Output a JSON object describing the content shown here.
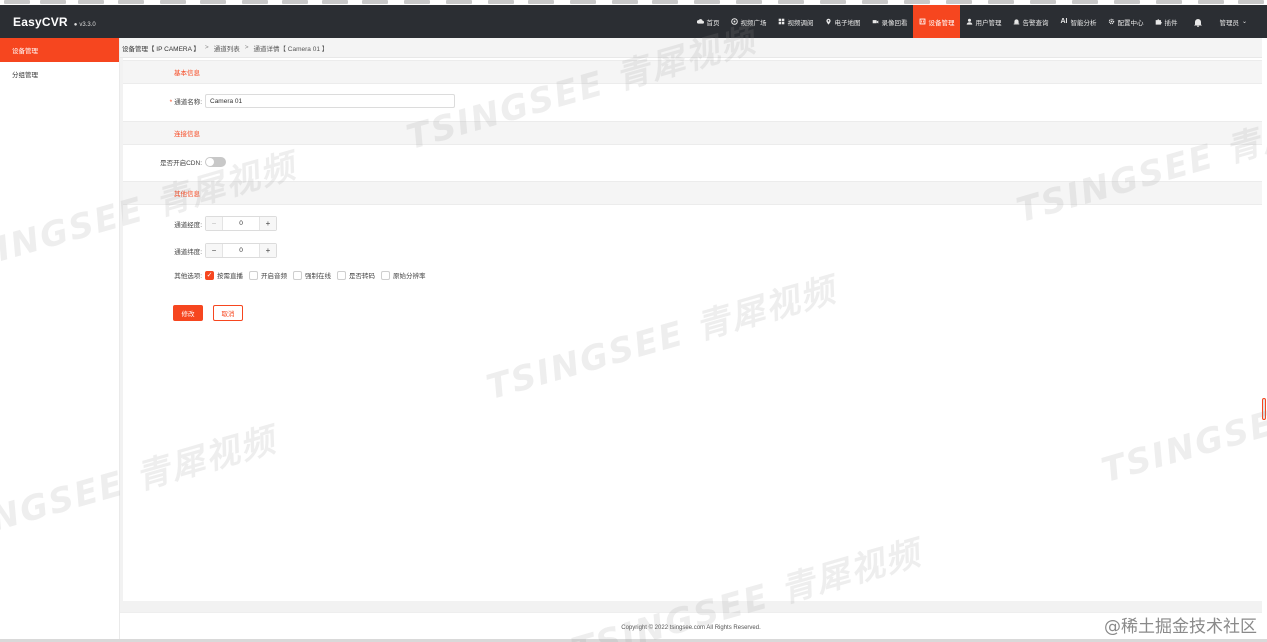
{
  "app": {
    "name": "EasyCVR",
    "version": "v3.3.0"
  },
  "nav": [
    {
      "label": "首页",
      "icon": "cloud-icon",
      "active": false
    },
    {
      "label": "视频广场",
      "icon": "compass-icon",
      "active": false
    },
    {
      "label": "视频调阅",
      "icon": "grid-icon",
      "active": false
    },
    {
      "label": "电子地图",
      "icon": "map-pin-icon",
      "active": false
    },
    {
      "label": "录像回看",
      "icon": "video-camera-icon",
      "active": false
    },
    {
      "label": "设备管理",
      "icon": "device-icon",
      "active": true
    },
    {
      "label": "用户管理",
      "icon": "user-icon",
      "active": false
    },
    {
      "label": "告警查询",
      "icon": "alarm-icon",
      "active": false
    },
    {
      "label": "智能分析",
      "icon": "ai-icon",
      "active": false
    },
    {
      "label": "配置中心",
      "icon": "gear-icon",
      "active": false
    },
    {
      "label": "插件",
      "icon": "puzzle-icon",
      "active": false
    }
  ],
  "user": {
    "label": "管理员"
  },
  "sidebar": {
    "items": [
      {
        "label": "设备管理",
        "active": true
      },
      {
        "label": "分组管理",
        "active": false
      }
    ]
  },
  "breadcrumb": {
    "items": [
      "设备管理【 IP CAMERA 】",
      "通道列表",
      "通道详情【 Camera 01 】"
    ],
    "separator": ">"
  },
  "form": {
    "basic_title": "基本信息",
    "channel_name_label": "通道名称:",
    "channel_name_value": "Camera 01",
    "connection_title": "连接信息",
    "cdn_label": "是否开启CDN:",
    "cdn_enabled": false,
    "other_title": "其他信息",
    "longitude_label": "通道经度:",
    "longitude_value": "0",
    "latitude_label": "通道纬度:",
    "latitude_value": "0",
    "options_label": "其他选项:",
    "options": [
      {
        "label": "按需直播",
        "checked": true
      },
      {
        "label": "开启音频",
        "checked": false
      },
      {
        "label": "强制在线",
        "checked": false
      },
      {
        "label": "是否转码",
        "checked": false
      },
      {
        "label": "原始分辨率",
        "checked": false
      }
    ],
    "submit_label": "修改",
    "cancel_label": "取消"
  },
  "footer": {
    "copyright": "Copyright © 2022 tsingsee.com All Rights Reserved."
  },
  "watermark": {
    "text": "TSINGSEE 青犀视频",
    "corner_text": "@稀土掘金技术社区"
  },
  "colors": {
    "accent": "#f6461f",
    "header_bg": "#2b2e33"
  }
}
